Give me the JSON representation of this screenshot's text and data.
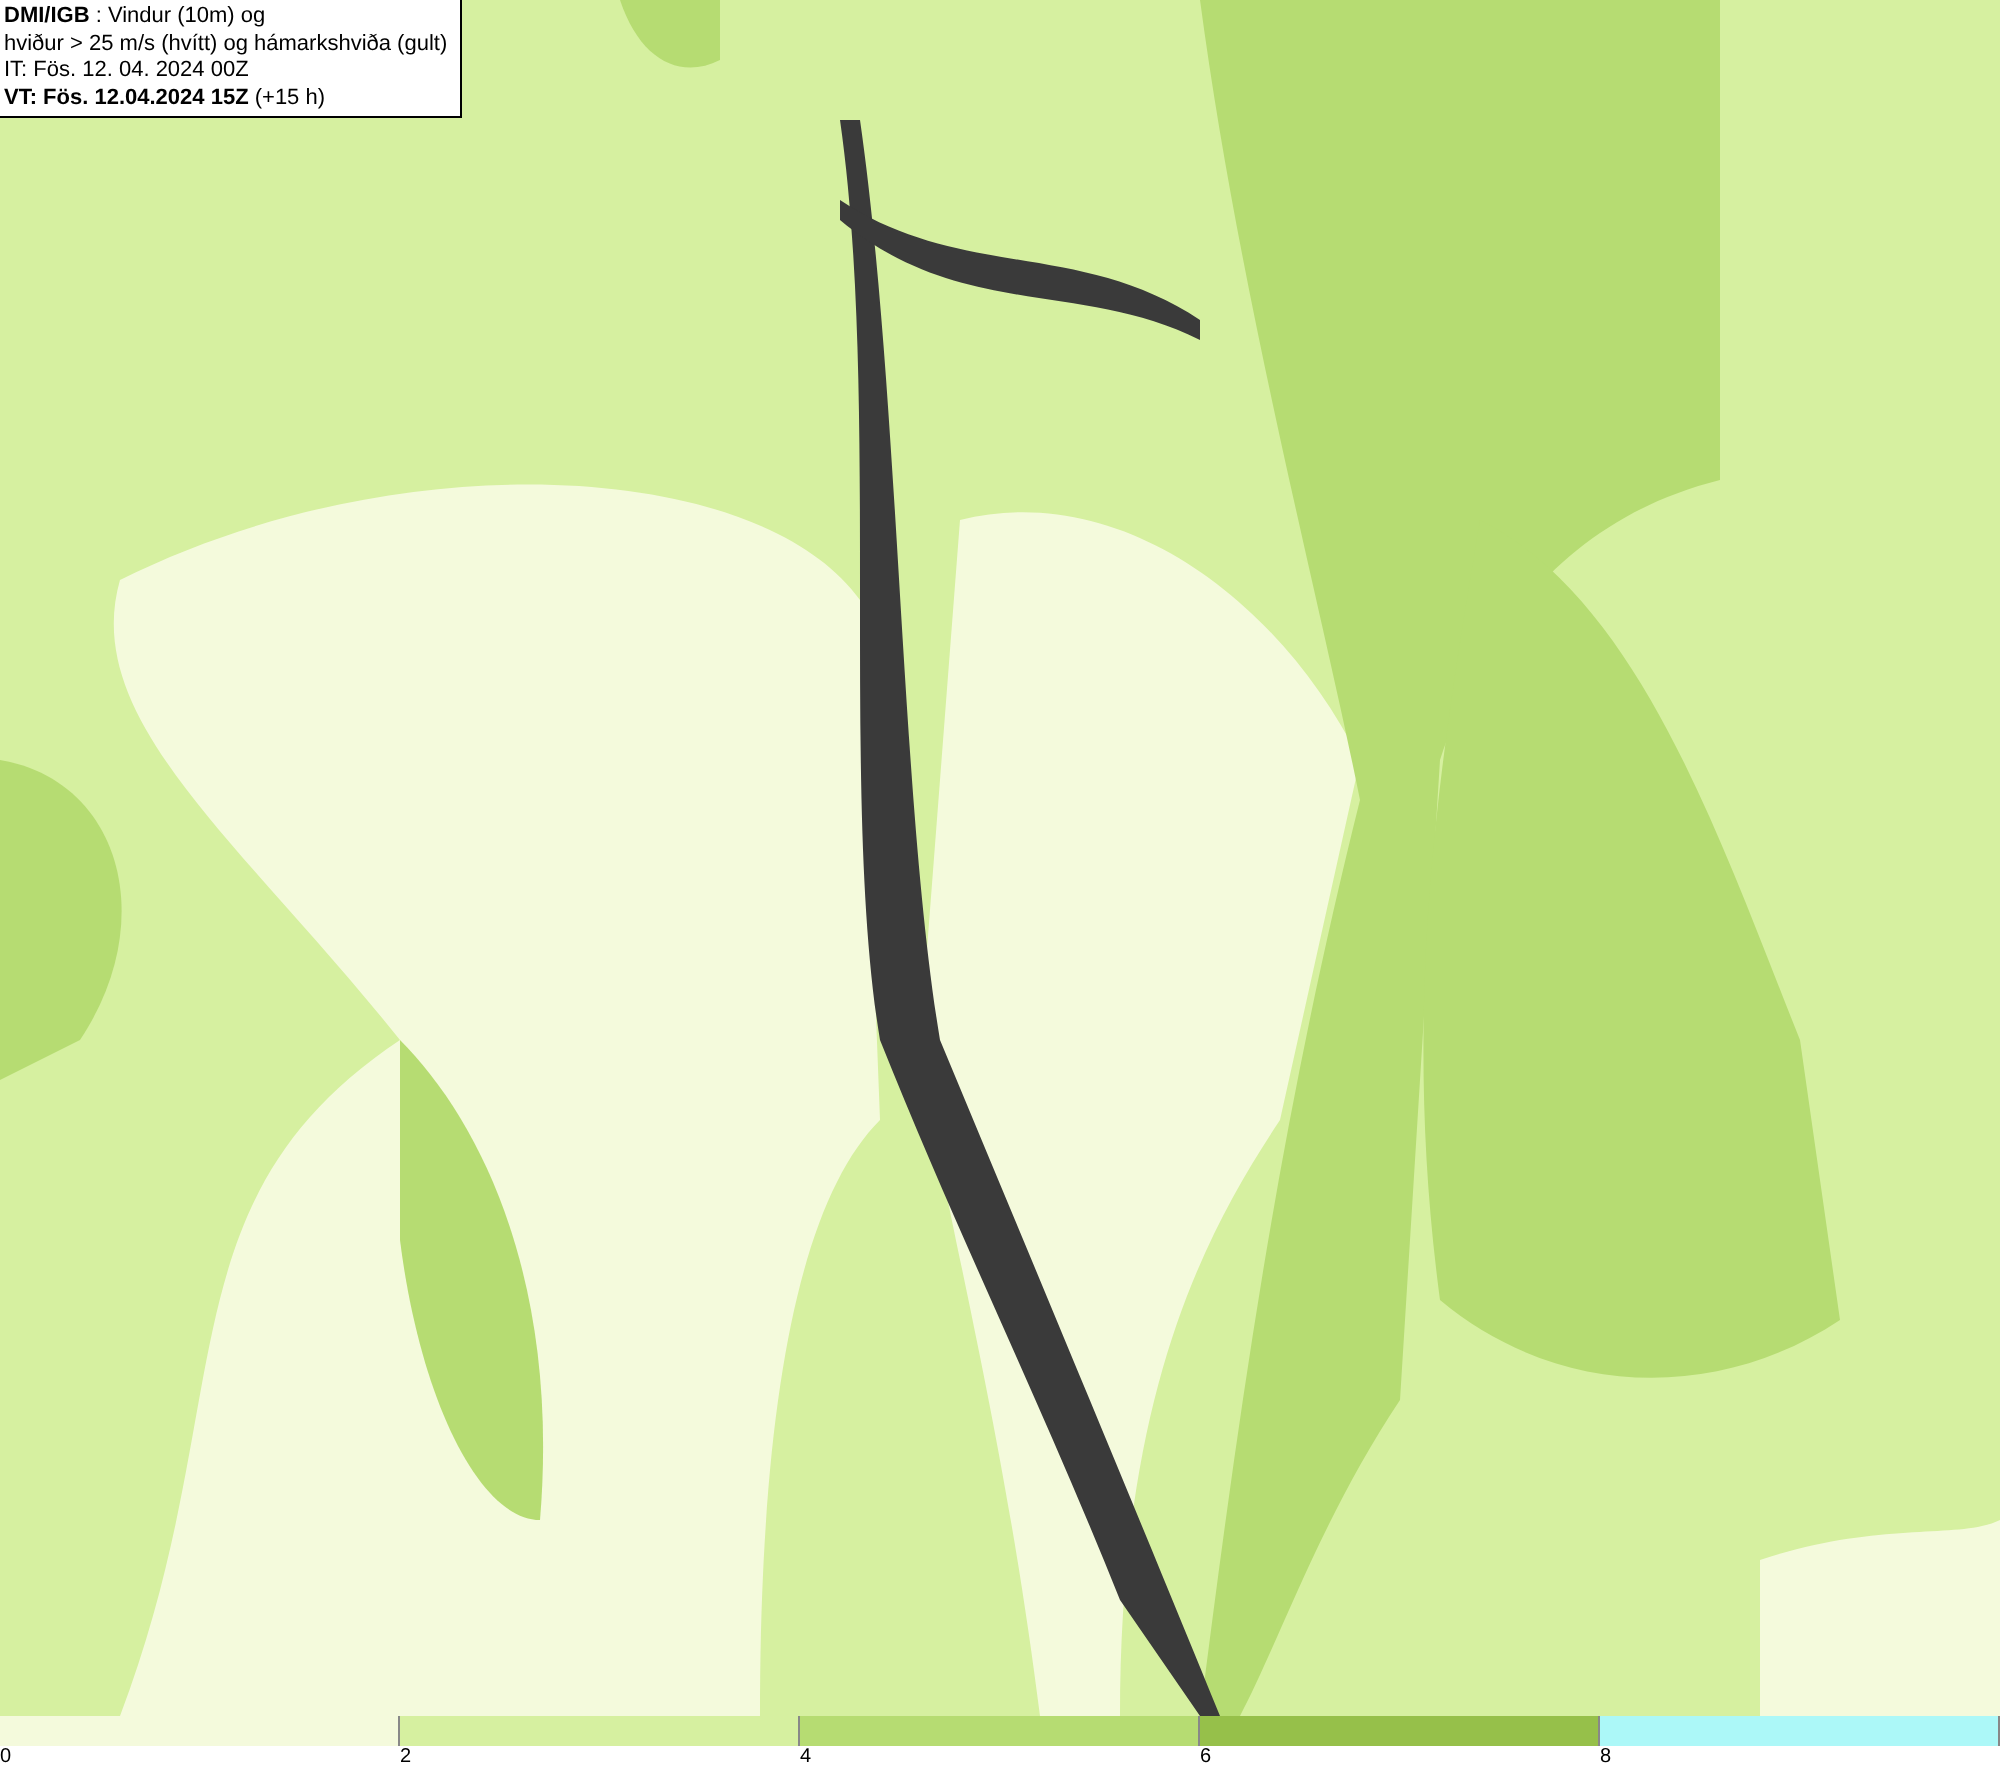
{
  "header": {
    "lines": [
      "**DMI/IGB** : Vindur (10m) og",
      "hviður > 25 m/s (hvítt) og hámarkshviða (gult)",
      "IT: Fös. 12. 04. 2024 00Z",
      "**VT: Fös. 12.04.2024 15Z** (+15 h)"
    ]
  },
  "legend": {
    "bins": [
      {
        "color": "#f4fadc",
        "label": "0"
      },
      {
        "color": "#d6f0a0",
        "label": "2"
      },
      {
        "color": "#b6dc72",
        "label": "4"
      },
      {
        "color": "#96c04a",
        "label": "6"
      },
      {
        "color": "#acf8f8",
        "label": "8"
      }
    ]
  }
}
